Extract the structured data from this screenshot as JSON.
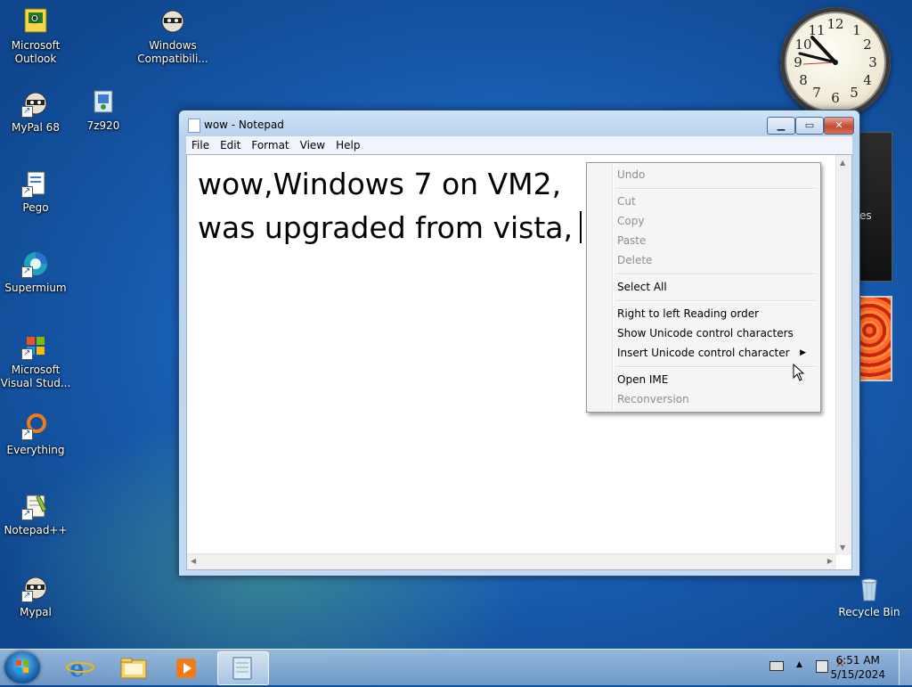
{
  "desktop": {
    "icons": [
      {
        "label1": "Microsoft",
        "label2": "Outlook"
      },
      {
        "label1": "Windows",
        "label2": "Compatibili..."
      },
      {
        "label1": "MyPal 68",
        "label2": ""
      },
      {
        "label1": "7z920",
        "label2": ""
      },
      {
        "label1": "Pego",
        "label2": ""
      },
      {
        "label1": "Supermium",
        "label2": ""
      },
      {
        "label1": "Microsoft",
        "label2": "Visual Stud..."
      },
      {
        "label1": "Everything",
        "label2": ""
      },
      {
        "label1": "Notepad++",
        "label2": ""
      },
      {
        "label1": "Mypal",
        "label2": ""
      }
    ],
    "recycle_bin": "Recycle Bin",
    "gadget_partial_text": "es"
  },
  "clock_numbers": [
    "12",
    "1",
    "2",
    "3",
    "4",
    "5",
    "6",
    "7",
    "8",
    "9",
    "10",
    "11"
  ],
  "notepad": {
    "title": "wow - Notepad",
    "menu": [
      "File",
      "Edit",
      "Format",
      "View",
      "Help"
    ],
    "text_line1": "wow,Windows 7 on VM2,",
    "text_line2": "was upgraded from vista,"
  },
  "context_menu": {
    "items": [
      {
        "label": "Undo",
        "enabled": false
      },
      {
        "label": "Cut",
        "enabled": false
      },
      {
        "label": "Copy",
        "enabled": false
      },
      {
        "label": "Paste",
        "enabled": false
      },
      {
        "label": "Delete",
        "enabled": false
      },
      {
        "label": "Select All",
        "enabled": true
      },
      {
        "label": "Right to left Reading order",
        "enabled": true
      },
      {
        "label": "Show Unicode control characters",
        "enabled": true
      },
      {
        "label": "Insert Unicode control character",
        "enabled": true
      },
      {
        "label": "Open IME",
        "enabled": true
      },
      {
        "label": "Reconversion",
        "enabled": false
      }
    ]
  },
  "taskbar": {
    "time": "6:51 AM",
    "date": "5/15/2024"
  },
  "colors": {
    "desktop_blue": "#1e6cc4",
    "close_red": "#c44a30",
    "menu_bg": "#f5f5f5"
  }
}
